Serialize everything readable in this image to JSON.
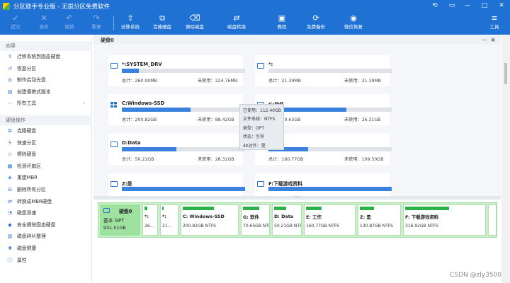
{
  "window": {
    "title": "分区助手专业版 - 无损分区免费软件",
    "controls": [
      "⟲",
      "▭",
      "—",
      "□",
      "✕"
    ]
  },
  "toolbar": {
    "undo_group": [
      {
        "label": "提交",
        "icon": "✓",
        "disabled": true
      },
      {
        "label": "放弃",
        "icon": "✕",
        "disabled": true
      },
      {
        "label": "撤销",
        "icon": "↶",
        "disabled": true
      },
      {
        "label": "重做",
        "icon": "↷",
        "disabled": true
      }
    ],
    "tools": [
      {
        "label": "迁移系统",
        "icon": "⇪"
      },
      {
        "label": "克隆硬盘",
        "icon": "⧉"
      },
      {
        "label": "擦除磁盘",
        "icon": "⌫"
      },
      {
        "label": "磁盘转换",
        "icon": "⇄"
      },
      {
        "label": "教程",
        "icon": "▣"
      },
      {
        "label": "免费备份",
        "icon": "⟳"
      },
      {
        "label": "微信恢复",
        "icon": "◉"
      },
      {
        "label": "工具",
        "icon": "≡"
      }
    ]
  },
  "sidebar": {
    "wizard_header": "向导",
    "wizard_items": [
      {
        "label": "迁移系统到固态硬盘",
        "icon": "migrate-icon",
        "glyph": "⇪"
      },
      {
        "label": "恢复分区",
        "icon": "restore-icon",
        "glyph": "↺"
      },
      {
        "label": "制作启动光盘",
        "icon": "disc-icon",
        "glyph": "◎"
      },
      {
        "label": "创建便携式版本",
        "icon": "portable-icon",
        "glyph": "▤"
      },
      {
        "label": "所有工具",
        "icon": "tools-icon",
        "glyph": "⋯",
        "chevron": "›"
      }
    ],
    "disk_ops_header": "硬盘操作",
    "disk_ops_items": [
      {
        "label": "克隆硬盘",
        "icon": "clone-icon",
        "glyph": "⧉"
      },
      {
        "label": "快速分区",
        "icon": "lightning-icon",
        "glyph": "ϟ"
      },
      {
        "label": "擦除硬盘",
        "icon": "erase-icon",
        "glyph": "◇"
      },
      {
        "label": "检测坏扇区",
        "icon": "scan-icon",
        "glyph": "▦"
      },
      {
        "label": "重建MBR",
        "icon": "rebuild-icon",
        "glyph": "◈"
      },
      {
        "label": "删除所有分区",
        "icon": "delete-icon",
        "glyph": "⊟"
      },
      {
        "label": "转换成MBR硬盘",
        "icon": "convert-icon",
        "glyph": "⇄"
      },
      {
        "label": "磁盘测速",
        "icon": "speed-icon",
        "glyph": "◔"
      },
      {
        "label": "安全擦除固态硬盘",
        "icon": "shield-icon",
        "glyph": "◆"
      },
      {
        "label": "磁盘碎片整理",
        "icon": "defrag-icon",
        "glyph": "▥"
      },
      {
        "label": "磁盘健康",
        "icon": "health-icon",
        "glyph": "✚"
      },
      {
        "label": "属性",
        "icon": "info-icon",
        "glyph": "ⓘ"
      }
    ]
  },
  "disk_panel": {
    "title": "硬盘0",
    "collapse_icon": "▭",
    "expand_icon": "▣"
  },
  "partitions": [
    {
      "name": "*:SYSTEM_DRV",
      "total": "总计：260.00MB",
      "free": "未使用：224.76MB",
      "used_ratio": 0.14,
      "icon": "drive-icon"
    },
    {
      "name": "*:",
      "total": "总计：21.39MB",
      "free": "未使用：21.39MB",
      "used_ratio": 0.0,
      "icon": "drive-icon"
    },
    {
      "name": "C:Windows-SSD",
      "total": "总计：200.82GB",
      "free": "未使用：88.42GB",
      "used_ratio": 0.56,
      "icon": "windows-icon"
    },
    {
      "name": "G:软件",
      "total": "总计：70.65GB",
      "free": "未使用：26.31GB",
      "used_ratio": 0.63,
      "icon": "drive-icon"
    },
    {
      "name": "D:Data",
      "total": "总计：50.21GB",
      "free": "未使用：28.31GB",
      "used_ratio": 0.44,
      "icon": "drive-icon"
    },
    {
      "name": "E:",
      "total": "总计：160.77GB",
      "free": "未使用：109.50GB",
      "used_ratio": 0.32,
      "icon": "drive-icon"
    },
    {
      "name": "Z:是",
      "total": "",
      "free": "",
      "used_ratio": 0.0,
      "icon": "drive-icon"
    },
    {
      "name": "F:下载游戏资料",
      "total": "",
      "free": "",
      "used_ratio": 0.0,
      "icon": "drive-icon"
    }
  ],
  "tooltip": {
    "used": "已使用：112.40GB",
    "fs": "文件系统：NTFS",
    "type": "类型：GPT",
    "status": "状态：引导",
    "align": "4K对齐：是"
  },
  "disk_map": {
    "disk_name": "硬盘0",
    "disk_type": "基本 GPT",
    "disk_size": "931.51GB",
    "splitter_glyph": "•••",
    "parts": [
      {
        "name": "*:",
        "info": "26...",
        "cap": 0.2
      },
      {
        "name": "*:",
        "info": "21...",
        "cap": 0.0
      },
      {
        "name": "C: Windows-SSD",
        "info": "200.82GB NTFS",
        "cap": 0.56
      },
      {
        "name": "G: 软件",
        "info": "70.65GB NTFS",
        "cap": 0.63
      },
      {
        "name": "D: Data",
        "info": "50.21GB NTFS",
        "cap": 0.44
      },
      {
        "name": "E: 工作",
        "info": "160.77GB NTFS",
        "cap": 0.32
      },
      {
        "name": "Z: 是",
        "info": "130.87GB NTFS",
        "cap": 0.35
      },
      {
        "name": "F: 下载游戏资料",
        "info": "316.92GB NTFS",
        "cap": 0.55
      },
      {
        "name": "",
        "info": "",
        "cap": 0.0
      }
    ]
  },
  "watermark": "CSDN @zly3500"
}
